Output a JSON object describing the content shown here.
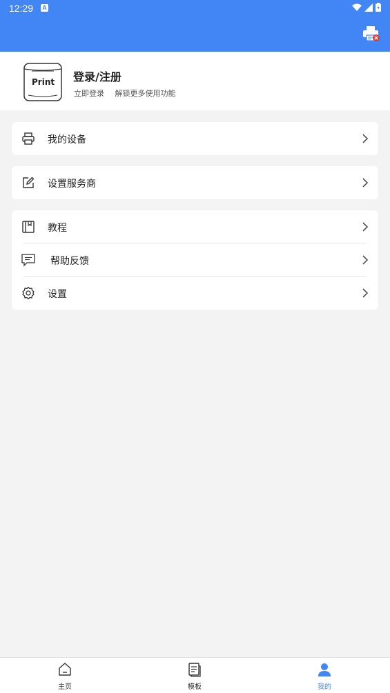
{
  "status_bar": {
    "time": "12:29",
    "notification_icon": "a-icon",
    "icons": [
      "wifi-icon",
      "signal-icon",
      "battery-icon"
    ]
  },
  "header": {
    "right_icon": "printer-disconnected-icon",
    "color": "#4285f4"
  },
  "profile": {
    "avatar_text": "Print",
    "title": "登录/注册",
    "subtitle": "立即登录 解锁更多使用功能"
  },
  "menu": {
    "my_devices": "我的设备",
    "service_provider": "设置服务商",
    "tutorial": "教程",
    "feedback": "帮助反馈",
    "settings": "设置"
  },
  "tabs": {
    "home": "主页",
    "templates": "模板",
    "mine": "我的",
    "active": "mine",
    "active_color": "#4285f4"
  }
}
